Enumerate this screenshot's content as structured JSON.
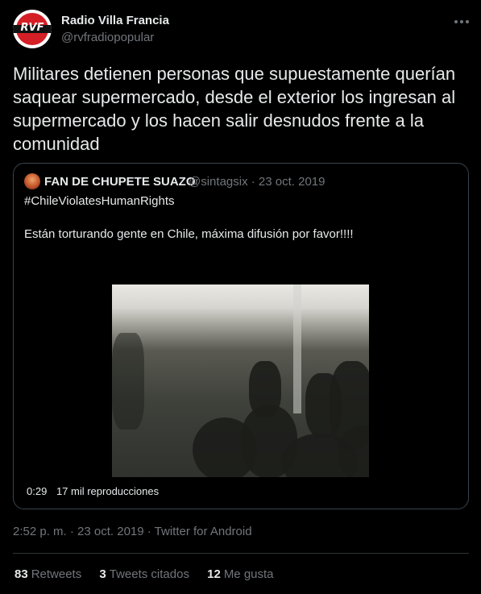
{
  "author": {
    "name": "Radio Villa Francia",
    "handle": "@rvfradiopopular",
    "avatar_text": "RVF"
  },
  "tweet": {
    "text": "Militares detienen personas que supuestamente querían saquear supermercado, desde el exterior los ingresan al supermercado y los hacen salir desnudos frente a la comunidad"
  },
  "quoted": {
    "name": "FAN DE CHUPETE SUAZO",
    "handle_date": "@sintagsix · 23 oct. 2019",
    "hashtag": "#ChileViolatesHumanRights",
    "text": "Están torturando gente en Chile, máxima difusión por favor!!!!",
    "video": {
      "duration": "0:29",
      "views": "17 mil reproducciones"
    }
  },
  "meta": {
    "timestamp": "2:52 p. m. · 23 oct. 2019 · ",
    "source": "Twitter for Android"
  },
  "stats": {
    "retweets_count": "83",
    "retweets_label": "Retweets",
    "quotes_count": "3",
    "quotes_label": "Tweets citados",
    "likes_count": "12",
    "likes_label": "Me gusta"
  },
  "icons": {
    "more": "more-horizontal-icon"
  }
}
